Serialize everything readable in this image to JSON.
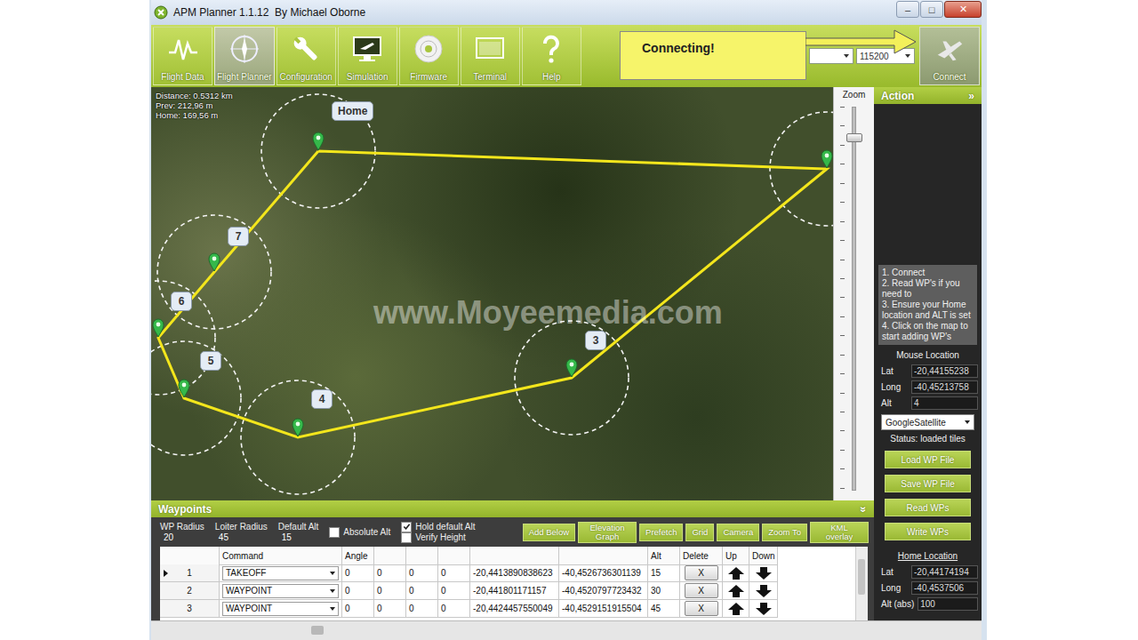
{
  "window": {
    "title": "APM Planner 1.1.12  By Michael Oborne",
    "controls": [
      "–",
      "□",
      "✕"
    ]
  },
  "toolbar": {
    "buttons": [
      {
        "label": "Flight Data",
        "selected": false
      },
      {
        "label": "Flight Planner",
        "selected": true
      },
      {
        "label": "Configuration",
        "selected": false
      },
      {
        "label": "Simulation",
        "selected": false
      },
      {
        "label": "Firmware",
        "selected": false
      },
      {
        "label": "Terminal",
        "selected": false
      },
      {
        "label": "Help",
        "selected": false
      }
    ],
    "callout": "Connecting!",
    "port": "",
    "baud": "115200",
    "connect": "Connect"
  },
  "map": {
    "stats": [
      "Distance: 0.5312 km",
      "Prev: 212,96 m",
      "Home: 169,56 m"
    ],
    "watermark": "www.Moyeemedia.com",
    "markers": [
      {
        "label": "Home"
      },
      {
        "label": "3"
      },
      {
        "label": "4"
      },
      {
        "label": "5"
      },
      {
        "label": "6"
      },
      {
        "label": "7"
      }
    ]
  },
  "zoom": {
    "label": "Zoom",
    "level": 0.93
  },
  "action": {
    "title": "Action",
    "collapse": "»",
    "help": [
      "1. Connect",
      "2. Read WP's if you need to",
      "3. Ensure your Home location and ALT is set",
      "4. Click on the map to start adding WP's"
    ],
    "mouse_location": {
      "title": "Mouse Location",
      "fields": [
        {
          "label": "Lat",
          "value": "-20,44155238"
        },
        {
          "label": "Long",
          "value": "-40,45213758"
        },
        {
          "label": "Alt",
          "value": "4"
        }
      ]
    },
    "map_type": "GoogleSatellite",
    "status": "Status: loaded tiles",
    "buttons": [
      "Load WP File",
      "Save WP File",
      "Read WPs",
      "Write WPs"
    ],
    "home_location": {
      "title": "Home Location",
      "fields": [
        {
          "label": "Lat",
          "value": "-20,44174194"
        },
        {
          "label": "Long",
          "value": "-40,4537506"
        },
        {
          "label": "Alt (abs)",
          "value": "100"
        }
      ]
    }
  },
  "waypoints": {
    "title": "Waypoints",
    "collapse": "»",
    "settings": [
      {
        "label": "WP Radius",
        "value": "20"
      },
      {
        "label": "Loiter Radius",
        "value": "45"
      },
      {
        "label": "Default Alt",
        "value": "15"
      }
    ],
    "checks": [
      {
        "label": "Absolute Alt",
        "checked": false
      },
      {
        "label": "Hold default Alt",
        "checked": true
      },
      {
        "label": "Verify Height",
        "checked": false
      }
    ],
    "buttons": [
      "Add Below",
      "Elevation Graph",
      "Prefetch",
      "Grid",
      "Camera",
      "Zoom To",
      "KML overlay"
    ],
    "table": {
      "columns": [
        "",
        "Command",
        "Angle",
        "",
        "",
        "",
        "",
        "",
        "Alt",
        "Delete",
        "Up",
        "Down"
      ],
      "rows": [
        {
          "num": "1",
          "selected": true,
          "command": "TAKEOFF",
          "params": [
            "0",
            "0",
            "0",
            "0"
          ],
          "lat": "-20,4413890838623",
          "lng": "-40,4526736301139",
          "alt": "15",
          "delete": "X"
        },
        {
          "num": "2",
          "selected": false,
          "command": "WAYPOINT",
          "params": [
            "0",
            "0",
            "0",
            "0"
          ],
          "lat": "-20,441801171157",
          "lng": "-40,4520797723432",
          "alt": "30",
          "delete": "X"
        },
        {
          "num": "3",
          "selected": false,
          "command": "WAYPOINT",
          "params": [
            "0",
            "0",
            "0",
            "0"
          ],
          "lat": "-20,4424457550049",
          "lng": "-40,4529151915504",
          "alt": "45",
          "delete": "X"
        }
      ]
    }
  }
}
